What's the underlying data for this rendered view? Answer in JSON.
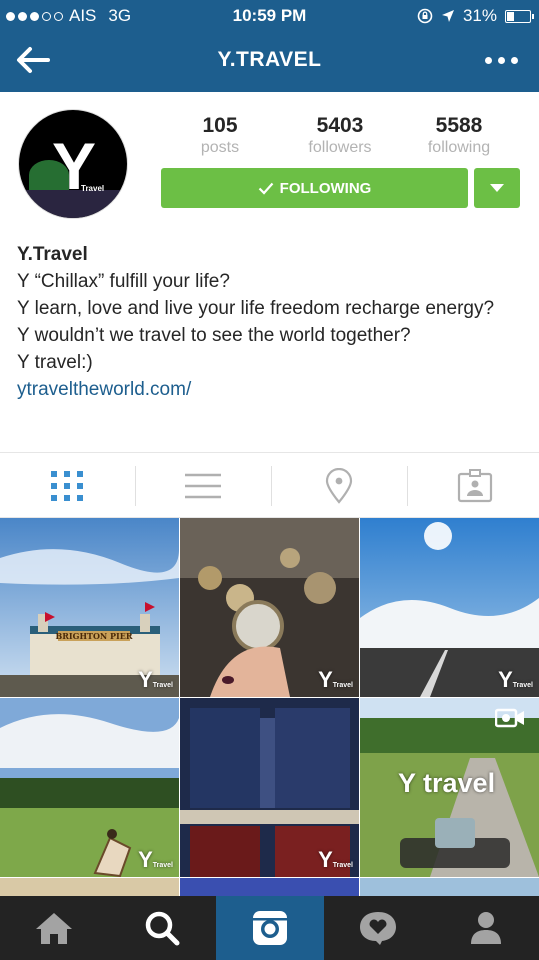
{
  "status_bar": {
    "carrier": "AIS",
    "network": "3G",
    "time": "10:59 PM",
    "battery": "31%",
    "battery_level": 0.31
  },
  "nav": {
    "title": "Y.TRAVEL",
    "back_icon": "arrow-left-icon",
    "more_icon": "more-dots-icon"
  },
  "profile": {
    "avatar_letter": "Y",
    "avatar_sub": "Travel",
    "stats": [
      {
        "value": "105",
        "label": "posts"
      },
      {
        "value": "5403",
        "label": "followers"
      },
      {
        "value": "5588",
        "label": "following"
      }
    ],
    "follow_label": "FOLLOWING"
  },
  "bio": {
    "name": "Y.Travel",
    "lines": [
      "Y “Chillax” fulfill your life?",
      "Y learn, love and live your life freedom recharge energy?",
      "Y wouldn’t we travel to see the world together?",
      "Y travel:)"
    ],
    "link": "ytraveltheworld.com/"
  },
  "tabs": [
    {
      "name": "grid-view",
      "icon": "grid-icon",
      "active": true
    },
    {
      "name": "list-view",
      "icon": "list-icon",
      "active": false
    },
    {
      "name": "map-view",
      "icon": "location-pin-icon",
      "active": false
    },
    {
      "name": "tagged-view",
      "icon": "tagged-photo-icon",
      "active": false
    }
  ],
  "photos": [
    {
      "name": "brighton-pier-photo",
      "watermark": "Y",
      "watermark_sub": "Travel",
      "sign": "BRIGHTON PIER"
    },
    {
      "name": "pocket-watches-photo",
      "watermark": "Y",
      "watermark_sub": "Travel"
    },
    {
      "name": "road-sky-photo",
      "watermark": "Y",
      "watermark_sub": "Travel"
    },
    {
      "name": "park-lawn-photo",
      "watermark": "Y",
      "watermark_sub": "Travel"
    },
    {
      "name": "books-photo",
      "watermark": "Y",
      "watermark_sub": "Travel"
    },
    {
      "name": "bike-path-video",
      "watermark": "Y travel",
      "video_icon": "video-camera-icon"
    }
  ],
  "bottom_nav": [
    {
      "name": "home",
      "icon": "home-icon",
      "active": false
    },
    {
      "name": "search",
      "icon": "search-icon",
      "active": false
    },
    {
      "name": "camera",
      "icon": "camera-icon",
      "active": true
    },
    {
      "name": "activity",
      "icon": "activity-heart-icon",
      "active": false
    },
    {
      "name": "profile",
      "icon": "profile-icon",
      "active": false
    }
  ],
  "colors": {
    "brand_blue": "#1d5e8e",
    "follow_green": "#6cbf45",
    "link_blue": "#1d5e8e",
    "bottom_bar": "#232323"
  }
}
